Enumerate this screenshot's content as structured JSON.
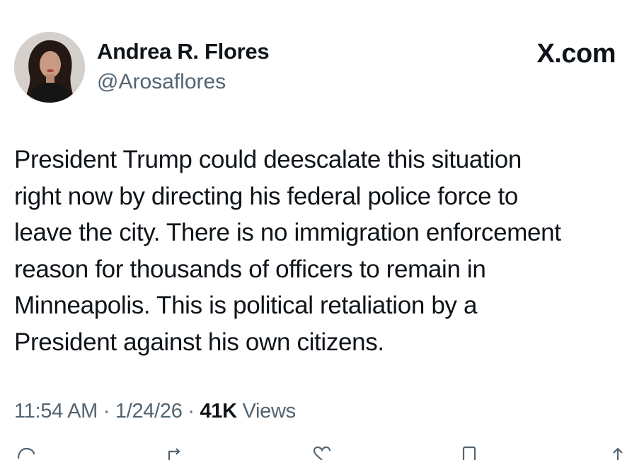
{
  "author": {
    "display_name": "Andrea R. Flores",
    "handle": "@Arosaflores"
  },
  "brand": "X.com",
  "tweet": {
    "text_lines": [
      "President Trump could deescalate this situation",
      "right now by directing his federal police force to",
      "leave the city. There is no immigration enforcement",
      "reason for thousands of officers to remain in",
      "Minneapolis. This is political retaliation by a",
      "President against his own citizens."
    ]
  },
  "meta": {
    "time": "11:54 AM",
    "separator": "·",
    "date": "1/24/26",
    "views_count": "41K",
    "views_label": "Views"
  },
  "action_icons": [
    "reply-icon",
    "repost-icon",
    "like-icon",
    "bookmark-icon",
    "share-icon"
  ],
  "colors": {
    "text_primary": "#0f1419",
    "text_secondary": "#536471",
    "background": "#ffffff"
  }
}
